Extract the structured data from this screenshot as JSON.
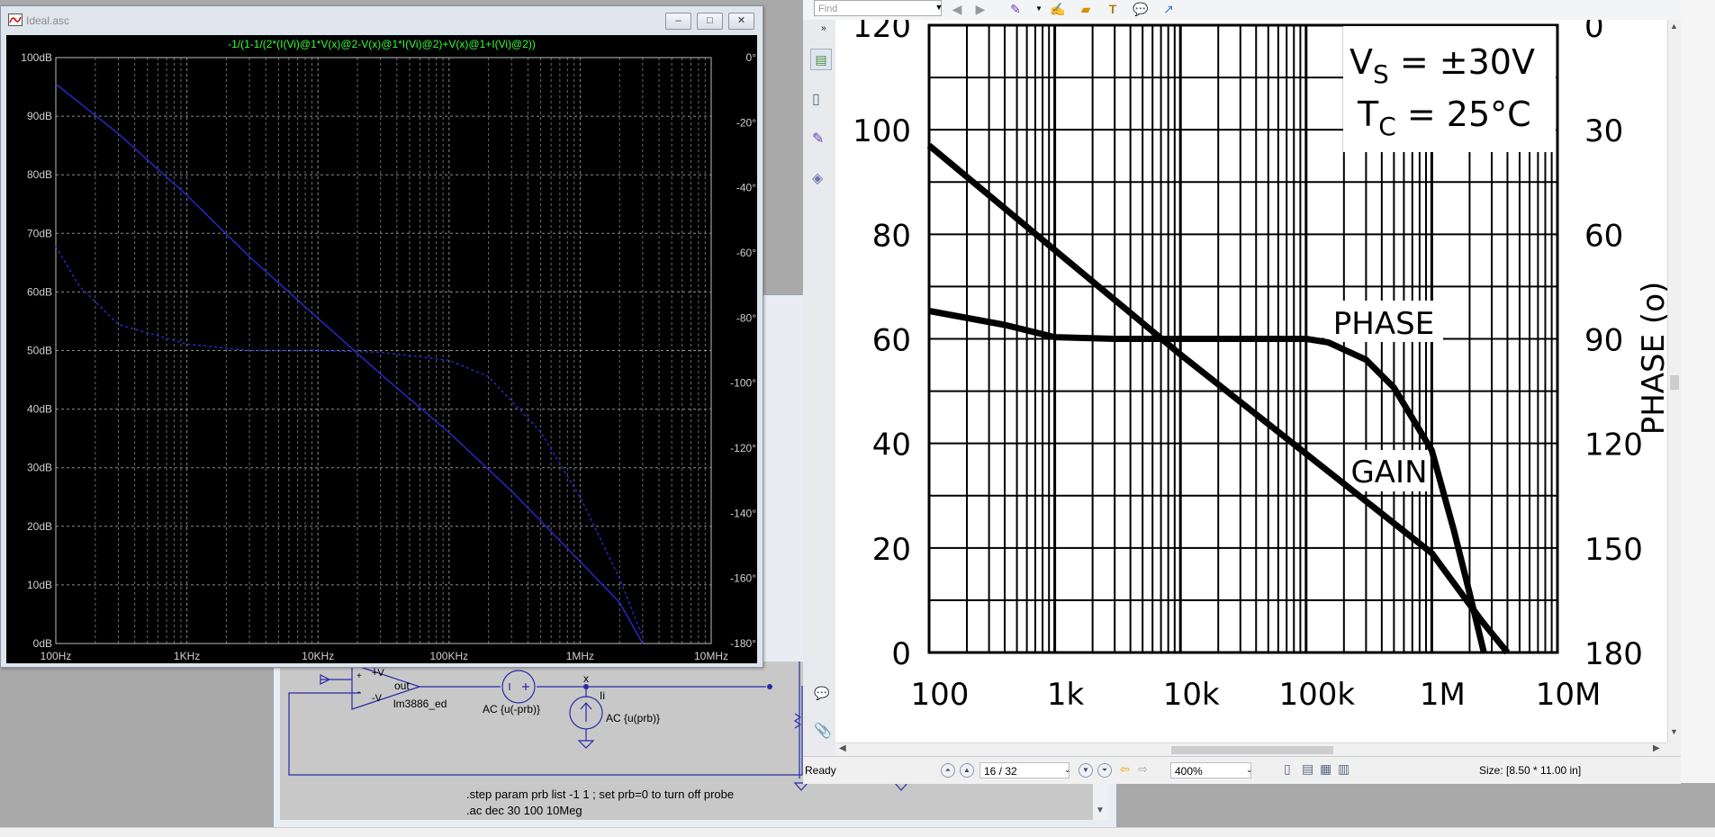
{
  "wave_window": {
    "title": "Ideal.asc",
    "expression": "-1/(1-1/(2*(I(Vi)@1*V(x)@2-V(x)@1*I(Vi)@2)+V(x)@1+I(Vi)@2))",
    "buttons": {
      "minimize": "–",
      "maximize": "□",
      "close": "✕"
    }
  },
  "schematic": {
    "opamp_plus": "+V",
    "opamp_out": "out",
    "opamp_neg": "-V",
    "opamp_in_plus": "+",
    "opamp_in_minus": "-",
    "opamp_name": "lm3886_ed",
    "vsource_label": "AC {u(-prb)}",
    "node_x": "x",
    "isource_name": "Ii",
    "isource_label": "AC {u(prb)}",
    "directive_step": ".step param prb list -1 1 ; set prb=0 to turn off probe",
    "directive_ac": ".ac dec 30 100 10Meg"
  },
  "pdf": {
    "find_placeholder": "Find",
    "status_ready": "Ready",
    "page_indicator": "16 / 32",
    "zoom": "400%",
    "size_text": "Size: [8.50 * 11.00 in]"
  },
  "chart_data": [
    {
      "type": "line",
      "title": "-1/(1-1/(2*(I(Vi)@1*V(x)@2-V(x)@1*I(Vi)@2)+V(x)@1+I(Vi)@2))",
      "x_scale": "log",
      "x_ticks": [
        "100Hz",
        "1KHz",
        "10KHz",
        "100KHz",
        "1MHz",
        "10MHz"
      ],
      "xlim": [
        100,
        10000000
      ],
      "y_ticks_left": [
        "100dB",
        "90dB",
        "80dB",
        "70dB",
        "60dB",
        "50dB",
        "40dB",
        "30dB",
        "20dB",
        "10dB",
        "0dB"
      ],
      "ylim_left": [
        0,
        100
      ],
      "y_ticks_right": [
        "0°",
        "-20°",
        "-40°",
        "-60°",
        "-80°",
        "-100°",
        "-120°",
        "-140°",
        "-160°",
        "-180°"
      ],
      "ylim_right": [
        -180,
        0
      ],
      "grid": true,
      "series": [
        {
          "axis": "left",
          "style": "solid",
          "color": "#2a2ad0",
          "x": [
            100,
            300,
            1000,
            3000,
            10000,
            30000,
            100000,
            300000,
            1000000,
            2000000,
            3000000
          ],
          "y": [
            95.5,
            87,
            76.5,
            66,
            55.5,
            46,
            36,
            26,
            14,
            7,
            0
          ]
        },
        {
          "axis": "right",
          "style": "dashed",
          "color": "#2a2ad0",
          "x": [
            100,
            150,
            300,
            1000,
            3000,
            10000,
            30000,
            100000,
            200000,
            500000,
            1000000,
            2000000,
            3000000
          ],
          "y": [
            -58,
            -70,
            -82,
            -88,
            -90,
            -90,
            -90.5,
            -93,
            -98,
            -115,
            -135,
            -160,
            -178
          ]
        }
      ]
    },
    {
      "type": "line",
      "x_scale": "log",
      "x_ticks": [
        "100",
        "1k",
        "10k",
        "100k",
        "1M",
        "10M"
      ],
      "xlim": [
        100,
        10000000
      ],
      "y_ticks_left": [
        "120",
        "100",
        "80",
        "60",
        "40",
        "20",
        "0"
      ],
      "ylim_left": [
        0,
        120
      ],
      "y_ticks_right": [
        "0",
        "30",
        "60",
        "90",
        "120",
        "150",
        "180"
      ],
      "ylim_right": [
        0,
        180
      ],
      "right_axis_label": "PHASE (o)",
      "annotations": {
        "vs_main": "V",
        "vs_sub": "S",
        "vs_rest": "= ±30V",
        "tc_main": "T",
        "tc_sub": "C",
        "tc_rest": "= 25°C",
        "phase": "PHASE",
        "gain": "GAIN"
      },
      "grid": true,
      "series": [
        {
          "name": "GAIN",
          "axis": "left",
          "x": [
            100,
            1000,
            10000,
            100000,
            1000000,
            2500000,
            4000000
          ],
          "y": [
            97,
            77,
            57,
            38,
            19,
            6,
            0
          ]
        },
        {
          "name": "PHASE",
          "axis": "right",
          "x": [
            100,
            400,
            1000,
            3000,
            10000,
            100000,
            150000,
            300000,
            500000,
            1000000,
            1500000,
            2000000,
            2600000
          ],
          "y": [
            82,
            86,
            89.5,
            90,
            90,
            90,
            91,
            96,
            104,
            122,
            145,
            163,
            180
          ]
        }
      ]
    }
  ]
}
